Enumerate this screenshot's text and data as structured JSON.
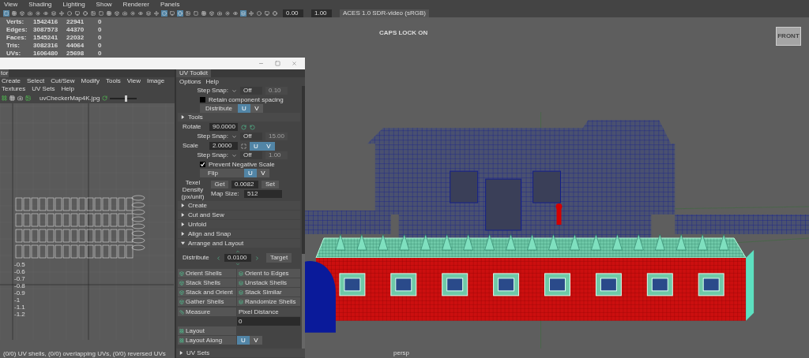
{
  "viewport_menu": [
    "View",
    "Shading",
    "Lighting",
    "Show",
    "Renderer",
    "Panels"
  ],
  "viewport_toolbar": {
    "buttons": [
      {
        "selected": true
      },
      {
        "selected": false
      },
      {
        "selected": false
      },
      {
        "selected": false
      },
      {
        "selected": false
      },
      {
        "selected": false
      },
      {
        "selected": false
      },
      {
        "selected": false
      },
      {
        "selected": false
      },
      {
        "selected": false
      },
      {
        "selected": false
      },
      {
        "selected": false
      },
      {
        "selected": false
      },
      {
        "selected": false
      },
      {
        "selected": false
      },
      {
        "selected": false
      },
      {
        "selected": false
      },
      {
        "selected": false
      },
      {
        "selected": false
      },
      {
        "selected": false
      },
      {
        "selected": true
      },
      {
        "selected": false
      },
      {
        "selected": true
      },
      {
        "selected": false
      },
      {
        "selected": false
      },
      {
        "selected": false
      },
      {
        "selected": false
      },
      {
        "selected": false
      },
      {
        "selected": false
      },
      {
        "selected": false
      },
      {
        "selected": true
      },
      {
        "selected": false
      },
      {
        "selected": false
      },
      {
        "selected": false
      },
      {
        "selected": false
      }
    ],
    "exposure": "0.00",
    "gamma": "1.00",
    "color_space": "ACES 1.0 SDR-video (sRGB)"
  },
  "stats": [
    {
      "label": "Verts:",
      "column_1": "1542416",
      "column_2": "22941",
      "column_3": "0"
    },
    {
      "label": "Edges:",
      "column_1": "3087573",
      "column_2": "44370",
      "column_3": "0"
    },
    {
      "label": "Faces:",
      "column_1": "1545241",
      "column_2": "22032",
      "column_3": "0"
    },
    {
      "label": "Tris:",
      "column_1": "3082316",
      "column_2": "44064",
      "column_3": "0"
    },
    {
      "label": "UVs:",
      "column_1": "1606480",
      "column_2": "25698",
      "column_3": "0"
    }
  ],
  "caps_lock": "CAPS LOCK ON",
  "view_cube": "FRONT",
  "camera": "persp",
  "uv_editor": {
    "tab": "tor",
    "menu": [
      "Create",
      "Select",
      "Cut/Sew",
      "Modify",
      "Tools",
      "View",
      "Image",
      "Textures",
      "UV Sets",
      "Help"
    ],
    "texture": "uvCheckerMap4K.jpg",
    "slider": {
      "level": 0.6
    },
    "axis_labels": [
      "-0.5",
      "-0.6",
      "-0.7",
      "-0.8",
      "-0.9",
      "-1",
      "-1.1",
      "-1.2"
    ],
    "status": "(0/0) UV shells, (0/0) overlapping UVs, (0/0) reversed UVs"
  },
  "uv_toolkit": {
    "title": "UV Toolkit",
    "menu": [
      "Options",
      "Help"
    ],
    "distribute_snap": {
      "label": "Step Snap:",
      "mode": "Off",
      "value": "0.10",
      "disabled": true
    },
    "retain_spacing": {
      "label": "Retain component spacing",
      "checked": false
    },
    "distribute": {
      "label": "Distribute",
      "axes": [
        {
          "label": "U",
          "selected": true
        },
        {
          "label": "V",
          "selected": false
        }
      ]
    },
    "tools_section": {
      "label": "Tools",
      "expanded": false
    },
    "rotate": {
      "label": "Rotate",
      "value": "90.0000",
      "snap": {
        "label": "Step Snap:",
        "mode": "Off",
        "value": "15.00",
        "disabled": true
      }
    },
    "scale": {
      "label": "Scale",
      "value": "2.0000",
      "axes": [
        {
          "label": "U",
          "selected": true
        },
        {
          "label": "V",
          "selected": true
        }
      ],
      "snap": {
        "label": "Step Snap:",
        "mode": "Off",
        "value": "1.00",
        "disabled": true
      }
    },
    "prevent_negative": {
      "label": "Prevent Negative Scale",
      "checked": true
    },
    "flip": {
      "label": "Flip",
      "axes": [
        {
          "label": "U",
          "selected": true
        },
        {
          "label": "V",
          "selected": false
        }
      ]
    },
    "texel": {
      "label": "Texel Density (px/unit)",
      "get": "Get",
      "value": "0.0082",
      "set": "Set",
      "map_size_label": "Map Size:",
      "map_size": "512"
    },
    "sections": [
      {
        "label": "Create",
        "expanded": false
      },
      {
        "label": "Cut and Sew",
        "expanded": false
      },
      {
        "label": "Unfold",
        "expanded": false
      },
      {
        "label": "Align and Snap",
        "expanded": false
      },
      {
        "label": "Arrange and Layout",
        "expanded": true
      }
    ],
    "arrange": {
      "distribute_label": "Distribute",
      "distribute_value": "0.0100",
      "target": "Target",
      "buttons": [
        "Orient Shells",
        "Orient to Edges",
        "Stack Shells",
        "Unstack Shells",
        "Stack and Orient",
        "Stack Similar",
        "Gather Shells",
        "Randomize Shells"
      ],
      "measure": "Measure",
      "measure_mode": "Pixel Distance",
      "measure_value": "0",
      "layout": "Layout",
      "layout_along": "Layout Along",
      "layout_axes": [
        {
          "label": "U",
          "selected": true
        },
        {
          "label": "V",
          "selected": false
        }
      ]
    },
    "last_section": {
      "label": "UV Sets",
      "expanded": false
    }
  }
}
